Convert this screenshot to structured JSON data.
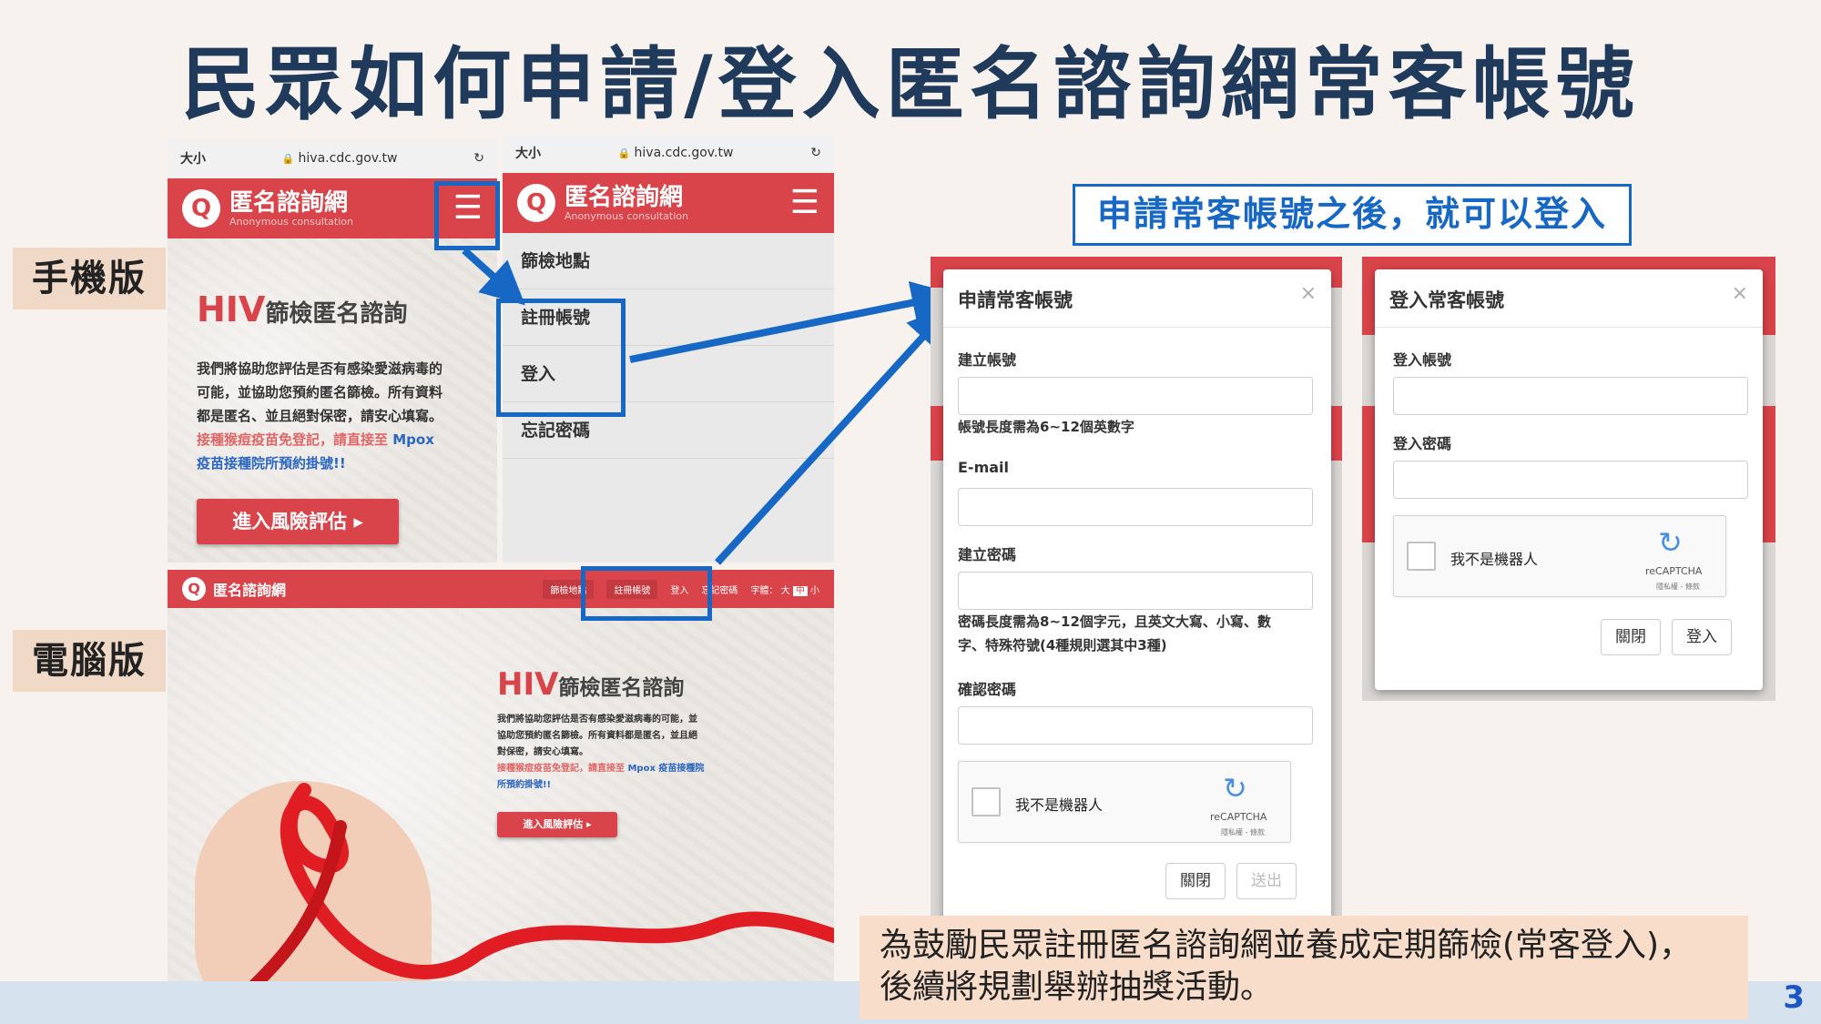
{
  "slide": {
    "title": "民眾如何申請/登入匿名諮詢網常客帳號",
    "page_number": "3",
    "mobile_label": "手機版",
    "desktop_label": "電腦版",
    "callout": "申請常客帳號之後，就可以登入",
    "note_line1": "為鼓勵民眾註冊匿名諮詢網並養成定期篩檢(常客登入)，",
    "note_line2": "後續將規劃舉辦抽獎活動。"
  },
  "browser": {
    "text_size": "大小",
    "url": "hiva.cdc.gov.tw"
  },
  "site": {
    "logo_glyph": "Q",
    "name": "匿名諮詢網",
    "name_en": "Anonymous consultation",
    "hero_hiv": "HIV",
    "hero_rest": "篩檢匿名諮詢",
    "hero_line1": "我們將協助您評估是否有感染愛滋病毒的",
    "hero_line2": "可能，並協助您預約匿名篩檢。所有資料",
    "hero_line3": "都是匿名、並且絕對保密，請安心填寫。",
    "hero_red": "接種猴痘疫苗免登記，請直接至",
    "hero_blue1": "Mpox",
    "hero_blue2": "疫苗接種院所預約掛號!!",
    "cta": "進入風險評估 ▸"
  },
  "mobile_menu": {
    "items": [
      "篩檢地點",
      "註冊帳號",
      "登入",
      "忘記密碼"
    ]
  },
  "desktop": {
    "nav": [
      "篩檢地點",
      "註冊帳號",
      "登入",
      "忘記密碼"
    ],
    "font_size_label": "字體：",
    "font_sizes": [
      "大",
      "中",
      "小"
    ],
    "hero_line1": "我們將協助您評估是否有感染愛滋病毒的可能，並",
    "hero_line2": "協助您預約匿名篩檢。所有資料都是匿名，並且絕",
    "hero_line3": "對保密，請安心填寫。",
    "hero_red": "接種猴痘疫苗免登記，請直接至",
    "hero_blue1": "Mpox 疫苗接種院",
    "hero_blue2": "所預約掛號!!",
    "cta": "進入風險評估 ▸"
  },
  "register_dialog": {
    "title": "申請常客帳號",
    "close": "×",
    "account_label": "建立帳號",
    "account_hint": "帳號長度需為6~12個英數字",
    "email_label": "E-mail",
    "password_label": "建立密碼",
    "password_hint_1": "密碼長度需為8~12個字元，且英文大寫、小寫、數",
    "password_hint_2": "字、特殊符號(4種規則選其中3種)",
    "confirm_label": "確認密碼",
    "captcha_text": "我不是機器人",
    "captcha_brand": "reCAPTCHA",
    "captcha_links": "隱私權 - 條款",
    "close_button": "關閉",
    "submit_button": "送出"
  },
  "login_dialog": {
    "title": "登入常客帳號",
    "close": "×",
    "account_label": "登入帳號",
    "password_label": "登入密碼",
    "captcha_text": "我不是機器人",
    "captcha_brand": "reCAPTCHA",
    "captcha_links": "隱私權 - 條款",
    "close_button": "關閉",
    "login_button": "登入"
  },
  "colors": {
    "brand_red": "#d9444a",
    "highlight_blue": "#1767c4",
    "title_navy": "#1f3a5a"
  }
}
